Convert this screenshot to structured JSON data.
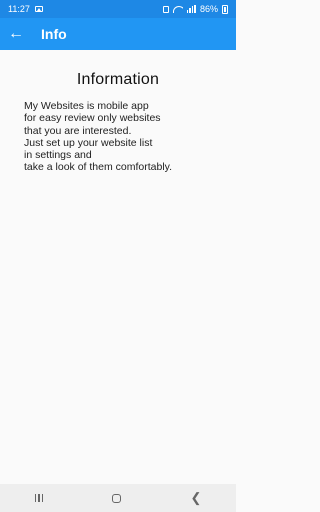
{
  "status_bar": {
    "time": "11:27",
    "battery": "86%"
  },
  "app_bar": {
    "back_icon": "arrow-left-icon",
    "title": "Info"
  },
  "content": {
    "title": "Information",
    "text": "My Websites is mobile app\nfor easy review only websites\nthat you are interested.\nJust set up your website list\nin settings and\ntake a look of them comfortably."
  },
  "nav_bar": {
    "icons": [
      "recents-icon",
      "home-icon",
      "back-icon"
    ]
  },
  "colors": {
    "app_bar": "#2196f3",
    "status_bar": "#1e88e5",
    "background": "#fafafa"
  }
}
